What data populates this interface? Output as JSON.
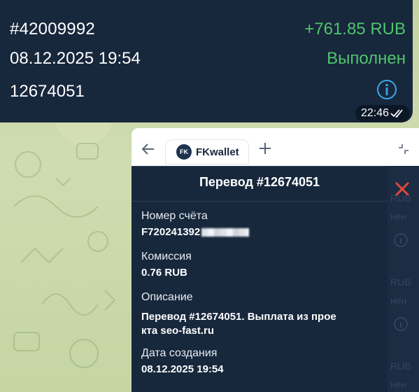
{
  "message": {
    "order_number": "#42009992",
    "datetime": "08.12.2025 19:54",
    "transfer_id": "12674051",
    "amount": "+761.85 RUB",
    "status": "Выполнен",
    "time": "22:46",
    "status_color": "#4ec56d",
    "info_icon": "info-icon",
    "read_icon": "double-check-icon"
  },
  "browser": {
    "tab_label": "FKwallet",
    "favicon_text": "FK"
  },
  "panel": {
    "title": "Перевод #12674051",
    "account_label": "Номер счёта",
    "account_value": "F720241392",
    "fee_label": "Комиссия",
    "fee_value": "0.76 RUB",
    "description_label": "Описание",
    "description_line1": "Перевод #12674051. Выплата из прое",
    "description_line2": "кта seo-fast.ru",
    "created_label": "Дата создания",
    "created_value": "08.12.2025 19:54"
  },
  "background_list": {
    "rows": [
      {
        "top_text": "RUB",
        "bottom_text": "нен"
      },
      {
        "top_text": "RUB",
        "bottom_text": "нен"
      },
      {
        "top_text": "RUB",
        "bottom_text": "нен"
      }
    ]
  }
}
